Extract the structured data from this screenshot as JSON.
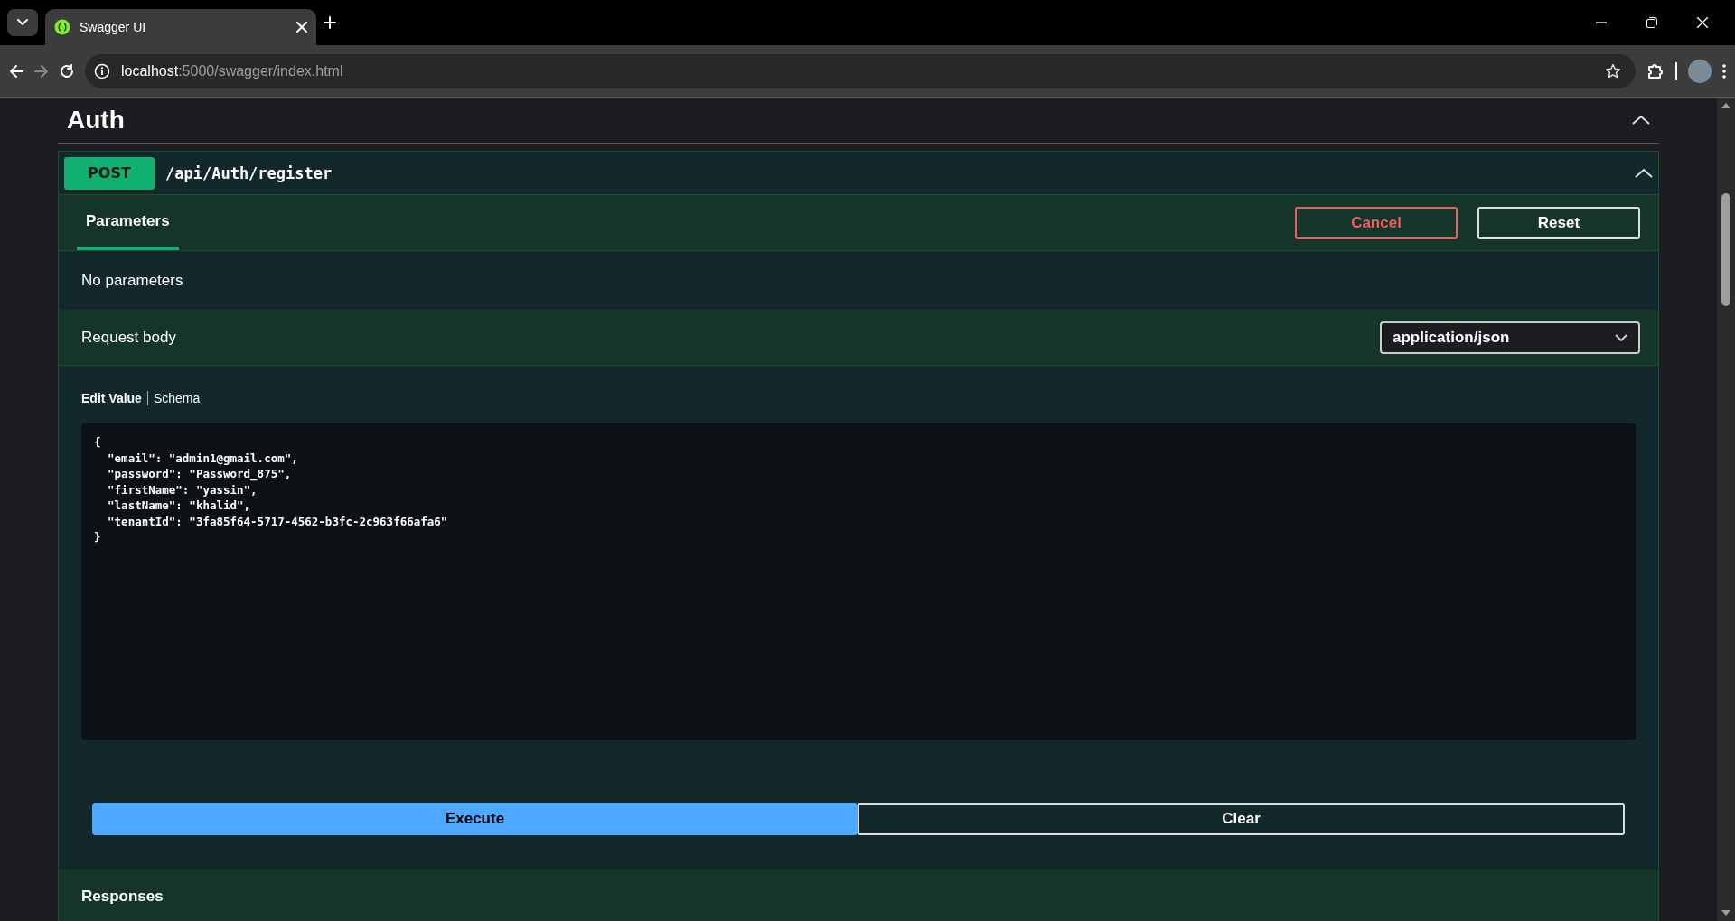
{
  "browser": {
    "tabs": [
      {
        "title": "Swagger UI",
        "selected": true
      }
    ],
    "address": {
      "host": "localhost",
      "path": ":5000/swagger/index.html"
    }
  },
  "section": {
    "title": "Auth",
    "expanded": true
  },
  "operation": {
    "method": "POST",
    "path": "/api/Auth/register",
    "expanded": true,
    "tabs": [
      {
        "label": "Parameters",
        "selected": true
      }
    ],
    "buttons": [
      {
        "label": "Cancel",
        "kind": "cancel"
      },
      {
        "label": "Reset",
        "kind": "reset"
      }
    ],
    "parameters_message": "No parameters",
    "request_body": {
      "label": "Request body",
      "content_type": "application/json",
      "tabs": [
        {
          "label": "Edit Value",
          "selected": true
        },
        {
          "label": "Schema",
          "selected": false
        }
      ],
      "value": "{\n  \"email\": \"admin1@gmail.com\",\n  \"password\": \"Password_875\",\n  \"firstName\": \"yassin\",\n  \"lastName\": \"khalid\",\n  \"tenantId\": \"3fa85f64-5717-4562-b3fc-2c963f66afa6\"\n}"
    },
    "actions": [
      {
        "label": "Execute",
        "kind": "primary"
      },
      {
        "label": "Clear",
        "kind": "secondary"
      }
    ],
    "responses_label": "Responses"
  }
}
